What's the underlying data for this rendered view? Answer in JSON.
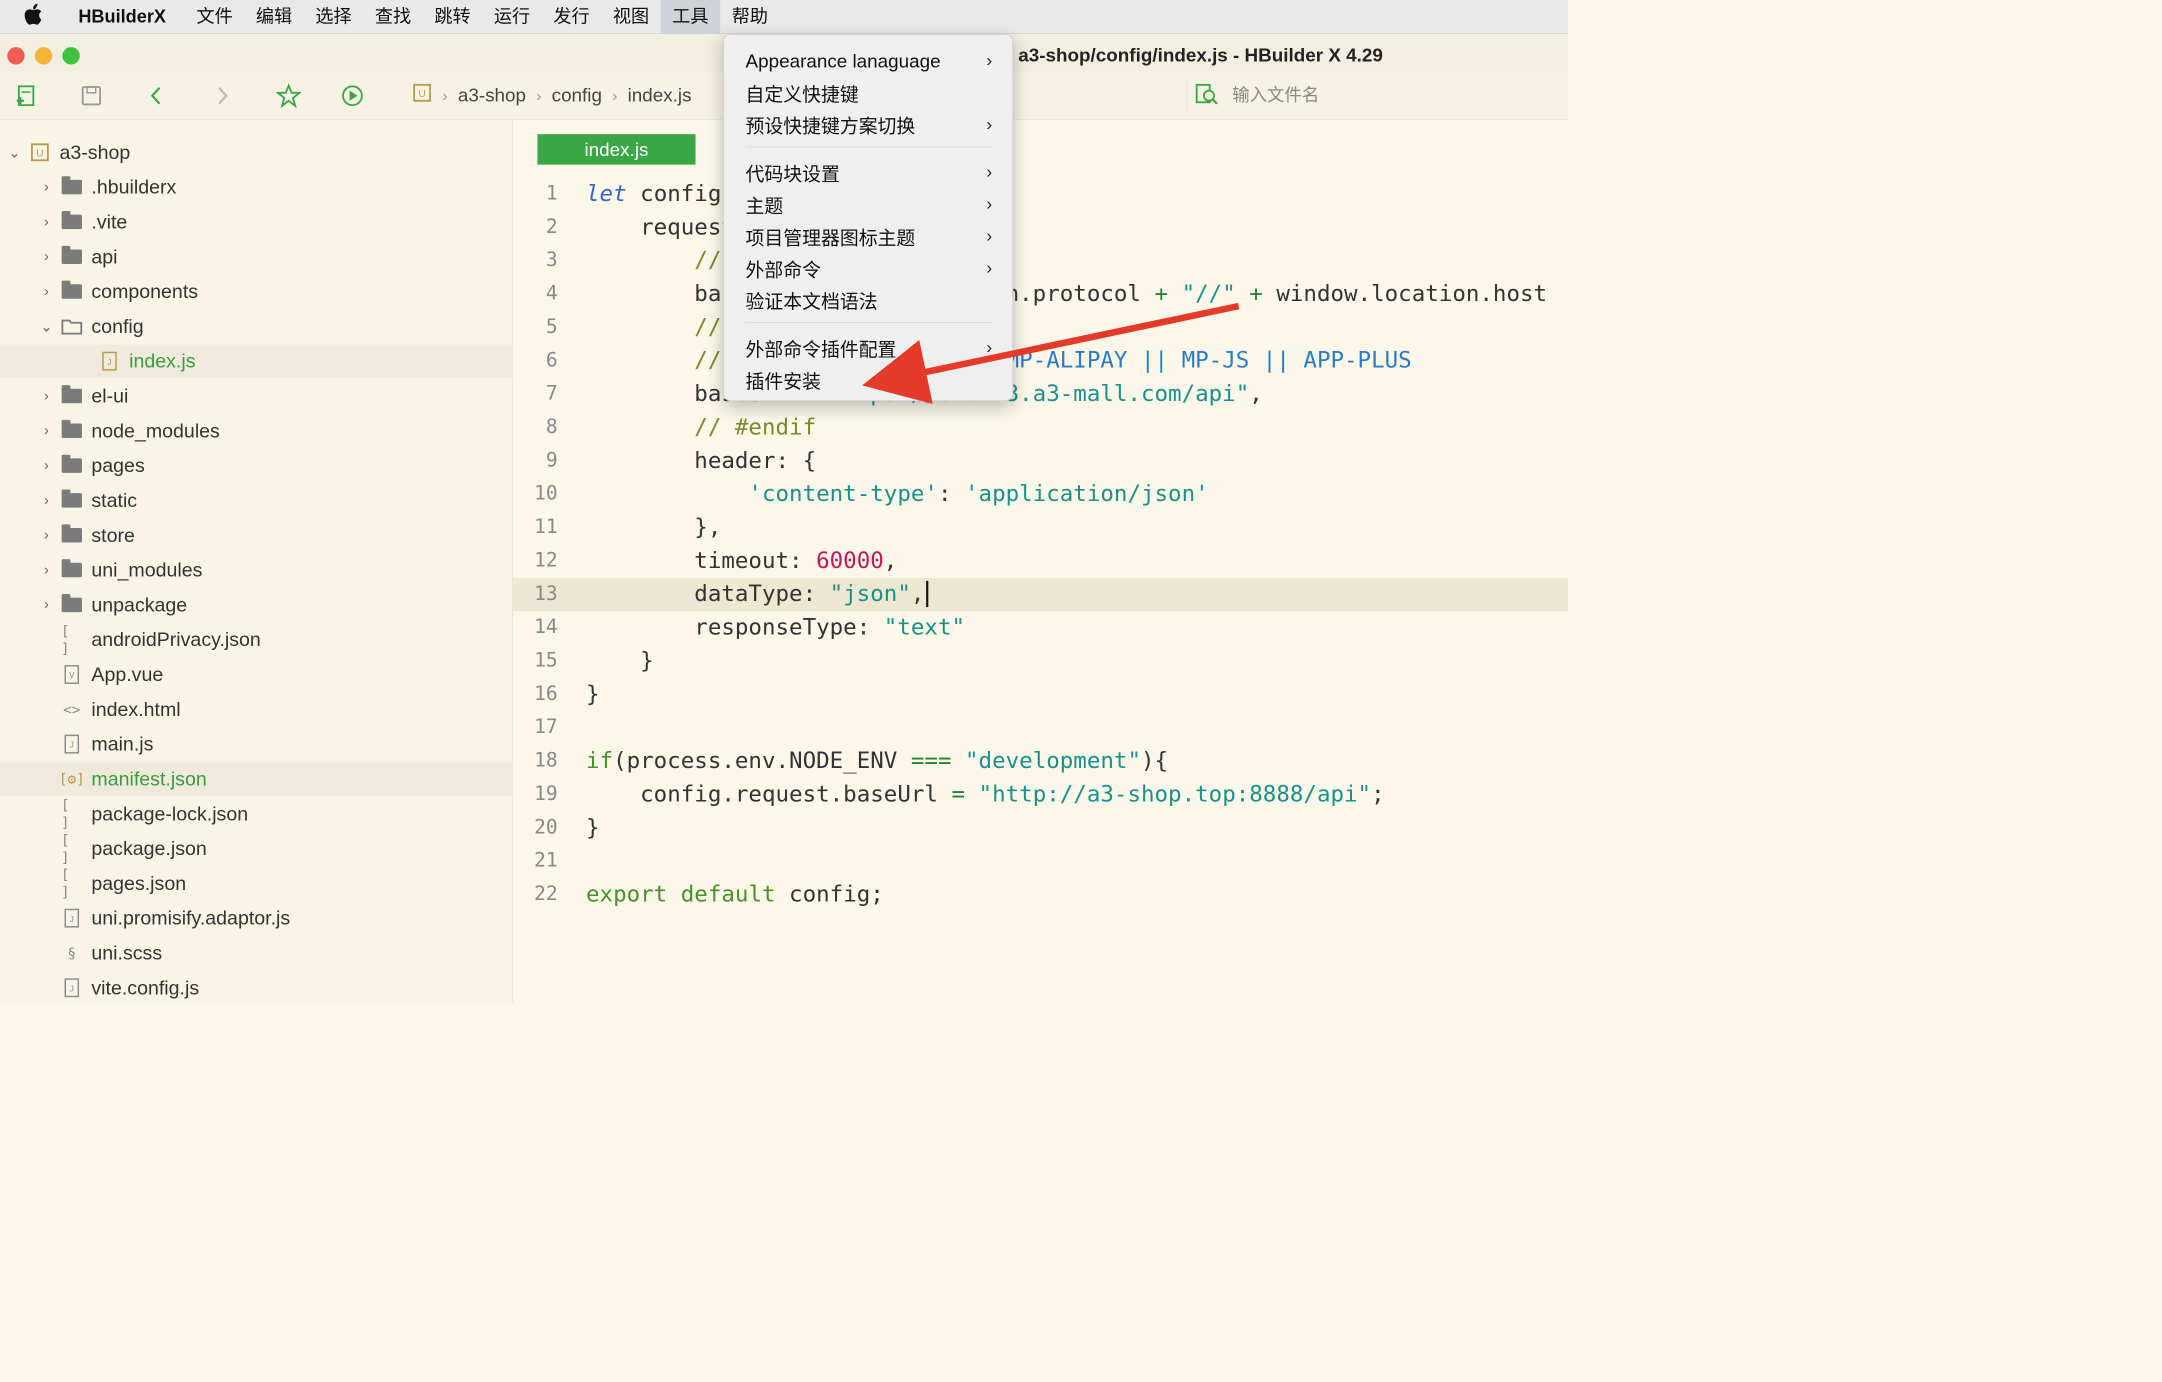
{
  "menubar": {
    "app": "HBuilderX",
    "items": [
      "文件",
      "编辑",
      "选择",
      "查找",
      "跳转",
      "运行",
      "发行",
      "视图",
      "工具",
      "帮助"
    ]
  },
  "window": {
    "title": "a3-shop/config/index.js - HBuilder X 4.29"
  },
  "breadcrumb": [
    "a3-shop",
    "config",
    "index.js"
  ],
  "search": {
    "placeholder": "输入文件名"
  },
  "sidebar": {
    "root": "a3-shop",
    "items": [
      ".hbuilderx",
      ".vite",
      "api",
      "components",
      "config",
      "index.js",
      "el-ui",
      "node_modules",
      "pages",
      "static",
      "store",
      "uni_modules",
      "unpackage",
      "androidPrivacy.json",
      "App.vue",
      "index.html",
      "main.js",
      "manifest.json",
      "package-lock.json",
      "package.json",
      "pages.json",
      "uni.promisify.adaptor.js",
      "uni.scss",
      "vite.config.js"
    ]
  },
  "editor": {
    "tab": "index.js",
    "line_numbers": [
      "1",
      "2",
      "3",
      "4",
      "5",
      "6",
      "7",
      "8",
      "9",
      "10",
      "11",
      "12",
      "13",
      "14",
      "15",
      "16",
      "17",
      "18",
      "19",
      "20",
      "21",
      "22"
    ],
    "current_line": 13
  },
  "tools_menu": {
    "items": [
      "Appearance lanaguage",
      "自定义快捷键",
      "预设快捷键方案切换",
      "代码块设置",
      "主题",
      "项目管理器图标主题",
      "外部命令",
      "验证本文档语法",
      "外部命令插件配置",
      "插件安装"
    ]
  },
  "colors": {
    "accent": "#3aa646",
    "arrow": "#e53a2a",
    "menu_active": "#cfd2d6"
  }
}
